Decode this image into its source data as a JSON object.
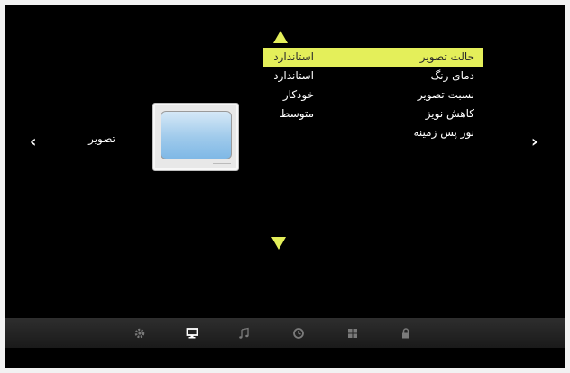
{
  "nav": {
    "prev_glyph": "‹",
    "next_glyph": "›"
  },
  "section": {
    "title": "تصویر"
  },
  "menu": {
    "items": [
      {
        "name": "حالت تصویر",
        "value": "استاندارد",
        "selected": true
      },
      {
        "name": "دمای رنگ",
        "value": "استاندارد",
        "selected": false
      },
      {
        "name": "نسبت تصویر",
        "value": "خودکار",
        "selected": false
      },
      {
        "name": "کاهش نویز",
        "value": "متوسط",
        "selected": false
      },
      {
        "name": "نور پس زمینه",
        "value": "",
        "selected": false
      }
    ]
  },
  "bottom_bar": {
    "icons": [
      "settings-gear-icon",
      "picture-monitor-icon",
      "sound-note-icon",
      "time-clock-icon",
      "apps-grid-icon",
      "lock-icon"
    ],
    "active": "picture-monitor-icon"
  },
  "colors": {
    "highlight": "#e4ef5a",
    "background": "#000000",
    "text": "#ffffff"
  }
}
